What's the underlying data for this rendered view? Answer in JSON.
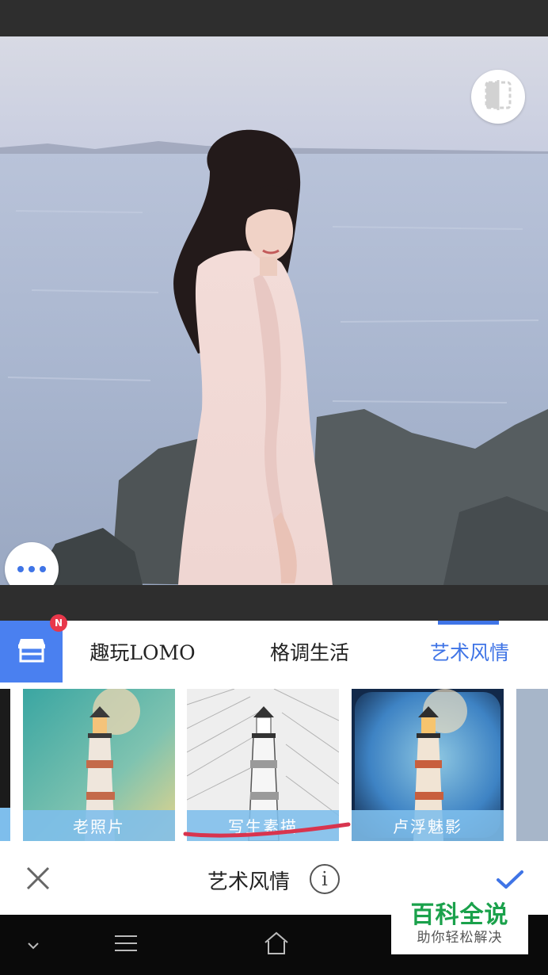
{
  "editor": {
    "compare_icon": "compare-split-icon",
    "more_icon": "more-dots-icon"
  },
  "filter_tabs": {
    "store_icon": "store-icon",
    "badge": "N",
    "items": [
      {
        "label": "趣玩LOMO",
        "active": false
      },
      {
        "label": "格调生活",
        "active": false
      },
      {
        "label": "艺术风情",
        "active": true
      }
    ]
  },
  "filters": [
    {
      "label": "老照片",
      "style": "vintage"
    },
    {
      "label": "写生素描",
      "style": "sketch",
      "highlighted": true
    },
    {
      "label": "卢浮魅影",
      "style": "vignette"
    }
  ],
  "bottom_bar": {
    "title": "艺术风情",
    "info_glyph": "i",
    "cancel_icon": "close-icon",
    "confirm_icon": "check-icon"
  },
  "nav_bar": {
    "items": [
      "chevron-down-icon",
      "menu-icon",
      "home-icon"
    ]
  },
  "watermark": {
    "title": "百科全说",
    "subtitle": "助你轻松解决"
  },
  "colors": {
    "accent": "#3f74e6",
    "badge": "#e8374a",
    "label_bg": "#7ebeec",
    "underline": "#d8344e",
    "watermark_green": "#1aa14b"
  }
}
